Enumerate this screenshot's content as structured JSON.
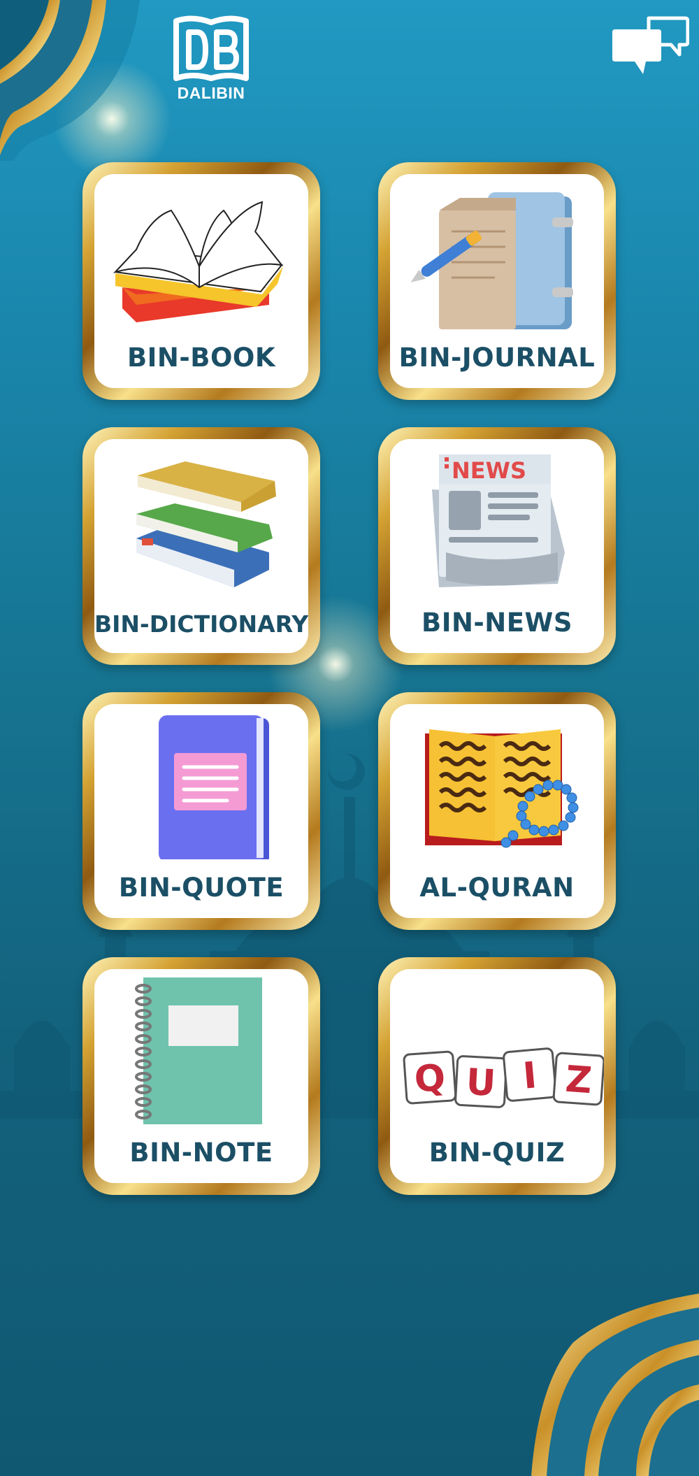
{
  "app": {
    "logo_text": "DALIBIN"
  },
  "header": {
    "chat_icon": "chat-bubbles-icon"
  },
  "menu": {
    "items": [
      {
        "label": "BIN-BOOK",
        "icon": "open-book-icon"
      },
      {
        "label": "BIN-JOURNAL",
        "icon": "journal-notebook-icon"
      },
      {
        "label": "BIN-DICTIONARY",
        "icon": "stacked-books-icon"
      },
      {
        "label": "BIN-NEWS",
        "icon": "newspaper-icon"
      },
      {
        "label": "BIN-QUOTE",
        "icon": "quote-book-icon"
      },
      {
        "label": "AL-QURAN",
        "icon": "quran-prayer-beads-icon"
      },
      {
        "label": "BIN-NOTE",
        "icon": "spiral-notebook-icon"
      },
      {
        "label": "BIN-QUIZ",
        "icon": "quiz-tiles-icon"
      }
    ],
    "news_badge_text": "NEWS",
    "quiz_letters": [
      "Q",
      "U",
      "I",
      "Z"
    ]
  },
  "colors": {
    "background_top": "#2199c2",
    "background_bottom": "#105872",
    "gold_frame": "#d4a233",
    "label_text": "#1b4f66"
  }
}
